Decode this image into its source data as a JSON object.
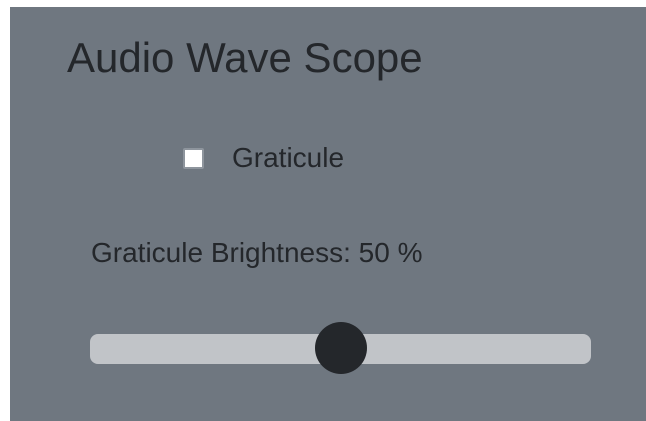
{
  "app": {
    "title": "Audio Wave Scope"
  },
  "graticule": {
    "label": "Graticule",
    "checked": false
  },
  "brightness": {
    "label_prefix": "Graticule Brightness: ",
    "value": 50,
    "unit": " %",
    "display": "Graticule Brightness: 50 %"
  },
  "colors": {
    "panel_background": "#6f7780",
    "text": "#24272b",
    "slider_track": "#c1c4c8",
    "slider_thumb": "#24272b",
    "checkbox_fill": "#ffffff"
  }
}
